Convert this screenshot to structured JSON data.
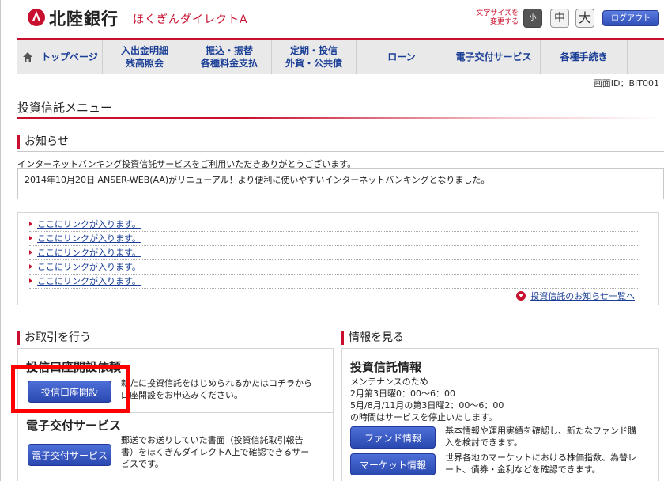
{
  "header": {
    "bank_name": "北陸銀行",
    "service_name": "ほくぎんダイレクトA",
    "font_size_label_1": "文字サイズを",
    "font_size_label_2": "変更する",
    "font_small": "小",
    "font_medium": "中",
    "font_large": "大",
    "logout": "ログアウト",
    "brand_color": "#c8102e"
  },
  "nav": {
    "home": "トップページ",
    "item1_line1": "入出金明細",
    "item1_line2": "残高照会",
    "item2_line1": "振込・振替",
    "item2_line2": "各種料金支払",
    "item3_line1": "定期・投信",
    "item3_line2": "外貨・公共債",
    "item4": "ローン",
    "item5": "電子交付サービス",
    "item6": "各種手続き"
  },
  "screen_id": "画面ID：BIT001",
  "page_title": "投資信託メニュー",
  "notice": {
    "heading": "お知らせ",
    "intro": "インターネットバンキング投資信託サービスをご利用いただきありがとうございます。",
    "message": "2014年10月20日 ANSER-WEB(AA)がリニューアル！より便利に使いやすいインターネットバンキングとなりました。"
  },
  "links": [
    "ここにリンクが入ります。",
    "ここにリンクが入ります。",
    "ここにリンクが入ります。",
    "ここにリンクが入ります。",
    "ここにリンクが入ります。"
  ],
  "more_link": "投資信託のお知らせ一覧へ",
  "transactions": {
    "heading": "お取引を行う",
    "account_title": "投信口座開設依頼",
    "account_button": "投信口座開設",
    "account_desc_1": "新たに投資信託をはじめられるかたはコチラから",
    "account_desc_2": "口座開設をお申込みください。",
    "edelivery_title": "電子交付サービス",
    "edelivery_button": "電子交付サービス",
    "edelivery_desc_1": "郵送でお送りしていた書面（投資信託取引報告",
    "edelivery_desc_2": "書）をほくぎんダイレクトA上で確認できるサー",
    "edelivery_desc_3": "ビスです。"
  },
  "info": {
    "heading": "情報を見る",
    "title": "投資信託情報",
    "maint_1": "メンテナンスのため",
    "maint_2": "2月第3日曜0：00～6：00",
    "maint_3": "5月/8月/11月の第3日曜2：00～6：00",
    "maint_4": "の時間はサービスを停止いたします。",
    "fund_button": "ファンド情報",
    "fund_desc_1": "基本情報や運用実績を確認し、新たなファンド購",
    "fund_desc_2": "入を検討できます。",
    "market_button": "マーケット情報",
    "market_desc_1": "世界各地のマーケットにおける株価指数、為替レ",
    "market_desc_2": "ート、債券・金利などを確認できます。"
  }
}
